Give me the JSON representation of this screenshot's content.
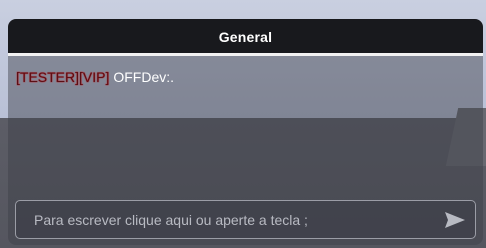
{
  "chat": {
    "title": "General",
    "messages": [
      {
        "tag": "[TESTER][VIP]",
        "author": "OFFDev:."
      }
    ],
    "input": {
      "placeholder": "Para escrever clique aqui ou aperte a tecla ;",
      "value": ""
    },
    "send_icon": "send-icon"
  },
  "colors": {
    "header_bg": "#18191d",
    "tag_color": "#5a0f14",
    "tag_glow": "#c0202a"
  }
}
